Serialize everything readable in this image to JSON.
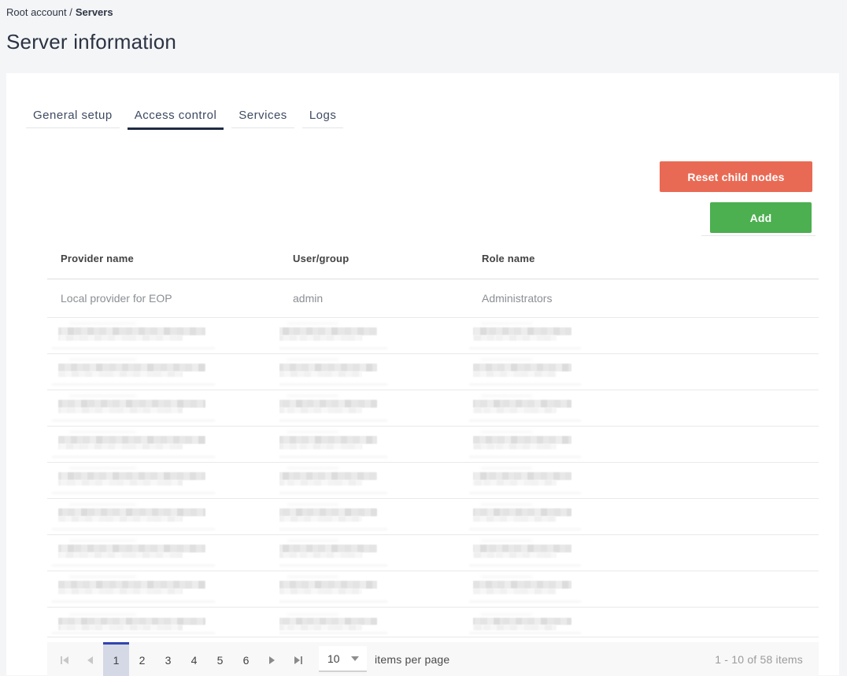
{
  "breadcrumb": {
    "parent": "Root account",
    "separator": "/",
    "current": "Servers"
  },
  "page": {
    "title": "Server information"
  },
  "tabs": [
    {
      "label": "General setup",
      "active": false
    },
    {
      "label": "Access control",
      "active": true
    },
    {
      "label": "Services",
      "active": false
    },
    {
      "label": "Logs",
      "active": false
    }
  ],
  "toolbar": {
    "reset_button": "Reset child nodes",
    "add_button": "Add"
  },
  "grid": {
    "columns": [
      "Provider name",
      "User/group",
      "Role name"
    ],
    "rows": [
      {
        "provider": "Local provider for EOP",
        "user": "admin",
        "role": "Administrators"
      }
    ],
    "redacted_row_count": 9
  },
  "pager": {
    "pages": [
      "1",
      "2",
      "3",
      "4",
      "5",
      "6"
    ],
    "current_page": "1",
    "page_size": "10",
    "items_per_page_label": "items per page",
    "info": "1 - 10 of 58 items"
  },
  "colors": {
    "reset_button": "#e96a54",
    "add_button": "#4caf50",
    "pager_selected_border": "#3144b0",
    "pager_selected_bg": "#d5d8e5"
  }
}
